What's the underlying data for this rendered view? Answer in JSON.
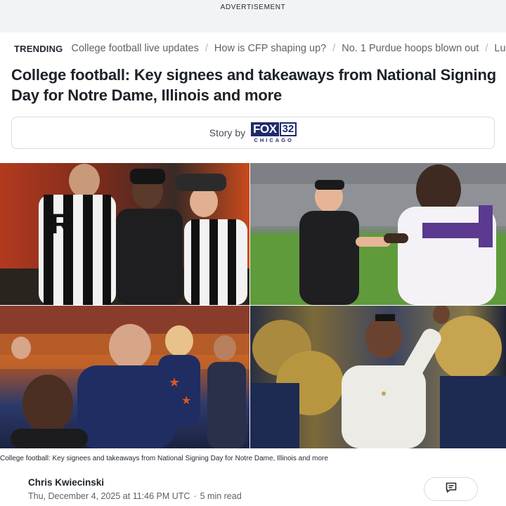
{
  "ad": {
    "label": "ADVERTISEMENT"
  },
  "trending": {
    "title": "TRENDING",
    "items": [
      "College football live updates",
      "How is CFP shaping up?",
      "No. 1 Purdue hoops blown out",
      "Luk"
    ]
  },
  "article": {
    "headline": "College football: Key signees and takeaways from National Signing Day for Notre Dame, Illinois and more",
    "story_by_label": "Story by",
    "source_logo": {
      "word": "FOX",
      "number": "32",
      "city": "CHICAGO"
    },
    "caption": "College football: Key signees and takeaways from National Signing Day for Notre Dame, Illinois and more",
    "author": "Chris Kwiecinski",
    "date": "Thu, December 4, 2025 at 11:46 PM UTC",
    "read_time": "5 min read"
  },
  "colors": {
    "ad_background": "#f1f3f5",
    "text_primary": "#1d2228",
    "text_secondary": "#5b636a",
    "fox_brand": "#1d2b6b"
  },
  "icons": {
    "comments": "comment-icon"
  }
}
